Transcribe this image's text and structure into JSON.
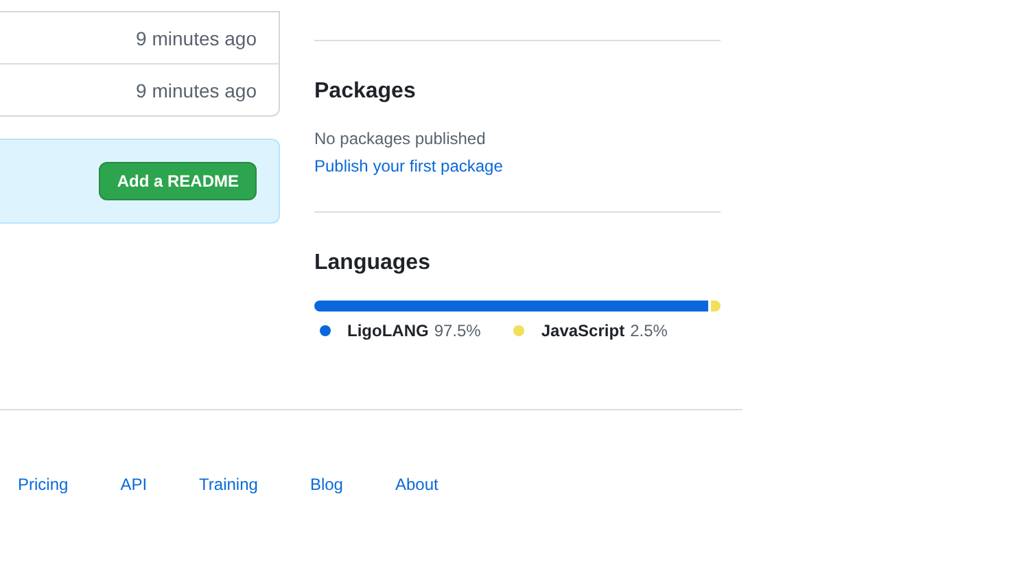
{
  "file_list": {
    "rows": [
      {
        "age": "9 minutes ago"
      },
      {
        "age": "9 minutes ago"
      }
    ]
  },
  "readme_banner": {
    "button": "Add a README"
  },
  "packages": {
    "title": "Packages",
    "text": "No packages published",
    "link": "Publish your first package"
  },
  "languages": {
    "title": "Languages",
    "items": [
      {
        "name": "LigoLANG",
        "percent": "97.5%",
        "level": 0.975,
        "color": "#0969da"
      },
      {
        "name": "JavaScript",
        "percent": "2.5%",
        "level": 0.025,
        "color": "#f1e05a"
      }
    ]
  },
  "footer": {
    "links": [
      "Pricing",
      "API",
      "Training",
      "Blog",
      "About"
    ]
  }
}
